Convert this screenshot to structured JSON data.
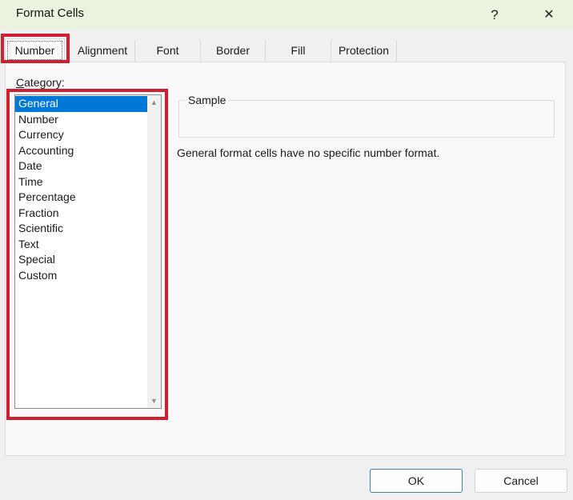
{
  "window": {
    "title": "Format Cells",
    "help_glyph": "?",
    "close_glyph": "✕"
  },
  "tabs": [
    {
      "label": "Number",
      "active": true
    },
    {
      "label": "Alignment",
      "active": false
    },
    {
      "label": "Font",
      "active": false
    },
    {
      "label": "Border",
      "active": false
    },
    {
      "label": "Fill",
      "active": false
    },
    {
      "label": "Protection",
      "active": false
    }
  ],
  "category": {
    "accel": "C",
    "rest": "ategory:"
  },
  "category_list": {
    "selected": "General",
    "items": [
      "General",
      "Number",
      "Currency",
      "Accounting",
      "Date",
      "Time",
      "Percentage",
      "Fraction",
      "Scientific",
      "Text",
      "Special",
      "Custom"
    ]
  },
  "icons": {
    "scroll_up": "▲",
    "scroll_down": "▼"
  },
  "sample": {
    "legend": "Sample",
    "value": ""
  },
  "description": "General format cells have no specific number format.",
  "buttons": {
    "ok": "OK",
    "cancel": "Cancel"
  },
  "colors": {
    "selection_blue": "#0078d7",
    "annotation_red": "#cf2030",
    "titlebar_green": "#ebf2e0",
    "ok_border_blue": "#4e7d9f"
  }
}
